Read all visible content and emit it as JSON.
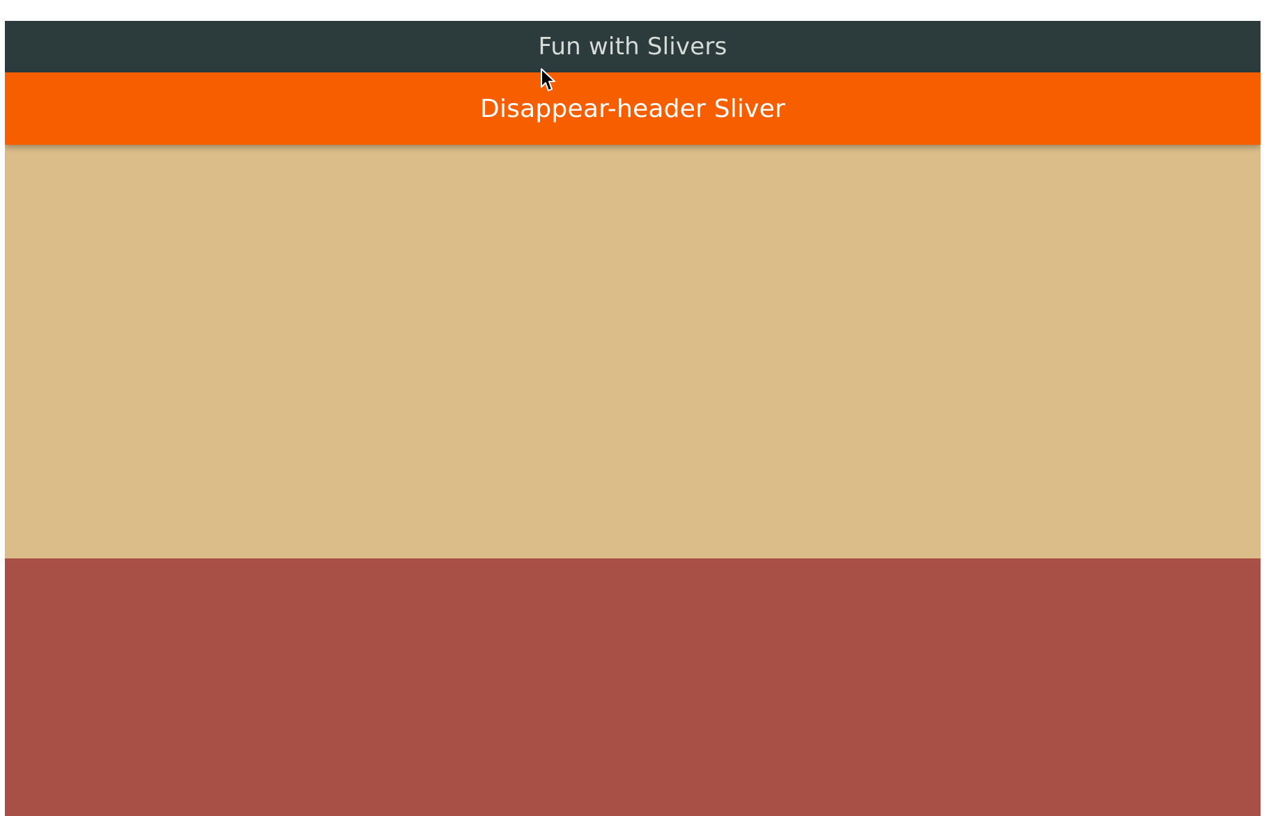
{
  "app_bar": {
    "title": "Fun with Slivers",
    "background": "#2c3b3b",
    "text_color": "#d7dcd9"
  },
  "sliver_header": {
    "title": "Disappear-header Sliver",
    "background": "#f75e00",
    "text_color": "#ffffff"
  },
  "content_blocks": [
    {
      "color": "#dbbd8a"
    },
    {
      "color": "#a85045"
    }
  ],
  "cursor": {
    "icon": "mouse-pointer-icon"
  }
}
